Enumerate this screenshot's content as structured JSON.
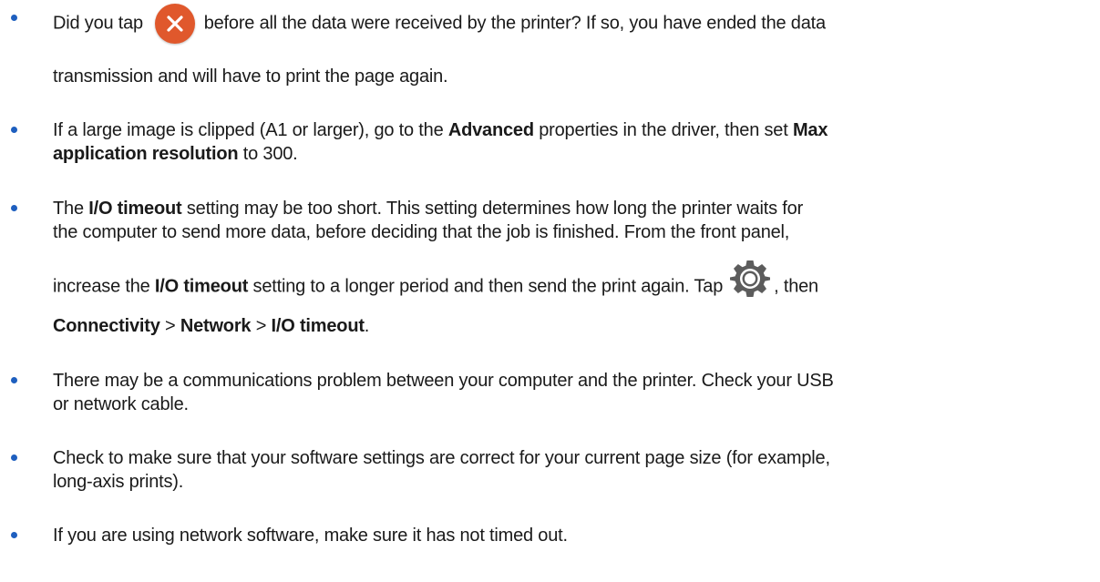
{
  "items": [
    {
      "l1_before": "Did you tap",
      "l1_after": "before all the data were received by the printer? If so, you have ended the data",
      "l2": "transmission and will have to print the page again."
    },
    {
      "l1_a": "If a large image is clipped (A1 or larger), go to the",
      "l1_b": "Advanced",
      "l1_c": "properties in the driver, then set",
      "l1_d": "Max",
      "l2_a": "application resolution",
      "l2_b": "to 300."
    },
    {
      "l1_a": "The",
      "l1_b": "I/O timeout",
      "l1_c": "setting may be too short. This setting determines how long the printer waits for",
      "l2": "the computer to send more data, before deciding that the job is finished. From the front panel,",
      "l3_a": "increase the",
      "l3_b": "I/O timeout",
      "l3_c": "setting to a longer period and then send the print again. Tap",
      "l3_d": ", then",
      "l4_a": "Connectivity",
      "l4_b": ">",
      "l4_c": "Network",
      "l4_d": ">",
      "l4_e": "I/O timeout",
      "l4_f": "."
    },
    {
      "l1": "There may be a communications problem between your computer and the printer. Check your USB",
      "l2": "or network cable."
    },
    {
      "l1": "Check to make sure that your software settings are correct for your current page size (for example,",
      "l2": "long-axis prints)."
    },
    {
      "l1": "If you are using network software, make sure it has not timed out."
    }
  ],
  "icons": {
    "cancel": "close-icon",
    "settings": "gear-icon"
  },
  "colors": {
    "bullet": "#1e5fbf",
    "cancel_button": "#e0582c",
    "text": "#1a1a1a"
  }
}
